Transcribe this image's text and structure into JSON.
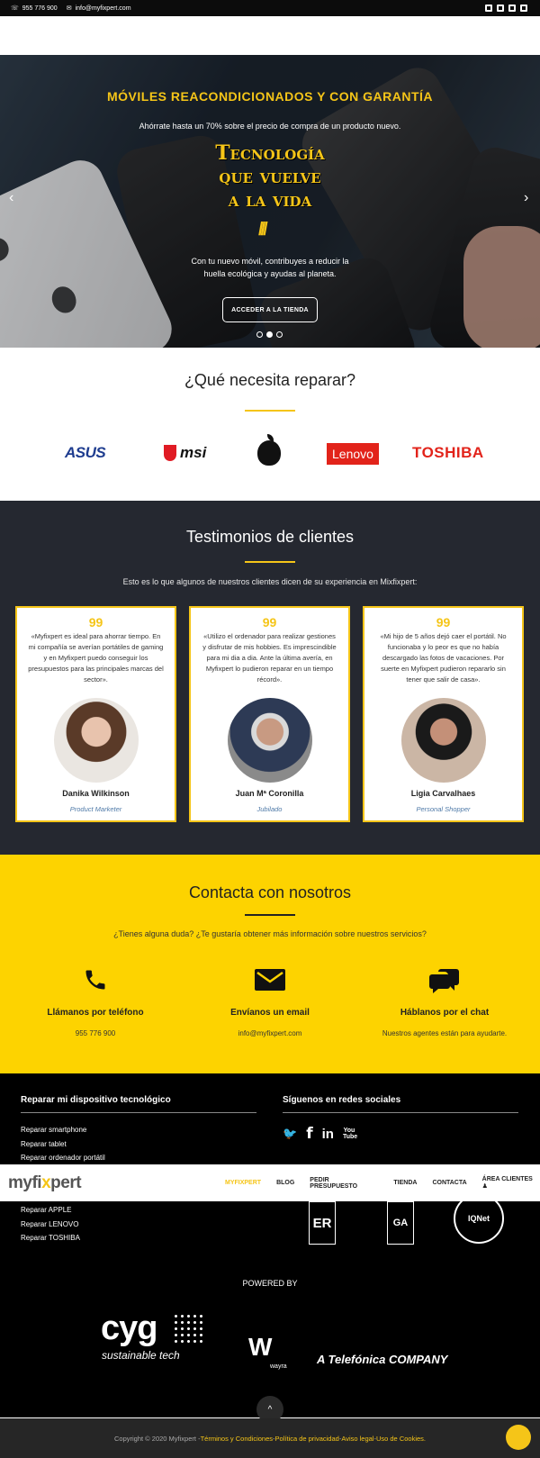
{
  "topbar": {
    "phone": "955 776 900",
    "email": "info@myfixpert.com",
    "social_icons": [
      "twitter-icon",
      "facebook-icon",
      "linkedin-icon",
      "youtube-icon"
    ]
  },
  "hero": {
    "title": "MÓVILES REACONDICIONADOS Y CON GARANTÍA",
    "subtitle": "Ahórrate hasta un 70% sobre el precio de compra de un producto nuevo.",
    "big_line1": "Tecnología",
    "big_line2": "que vuelve",
    "big_line3": "a la vida",
    "slash": "///",
    "text_line1": "Con tu nuevo móvil, contribuyes a reducir la",
    "text_line2": "huella ecológica y ayudas al planeta.",
    "button": "ACCEDER A LA TIENDA",
    "prev": "‹",
    "next": "›"
  },
  "repair": {
    "title": "¿Qué necesita reparar?",
    "brands": [
      "ASUS",
      "msi",
      "Lenovo",
      "TOSHIBA"
    ]
  },
  "testimonials": {
    "title": "Testimonios de clientes",
    "intro": "Esto es lo que algunos de nuestros clientes dicen de su experiencia en Mixfixpert:",
    "quote_mark": "99",
    "items": [
      {
        "quote": "«Myfixpert es ideal para ahorrar tiempo. En mi compañía se averían portátiles de gaming y en Myfixpert puedo conseguir los presupuestos para las principales marcas del sector».",
        "name": "Danika Wilkinson",
        "role": "Product Marketer"
      },
      {
        "quote": "«Utilizo el ordenador para realizar gestiones y disfrutar de mis hobbies. Es imprescindible para mi dia a dia. Ante la última avería, en Myfixpert lo pudieron reparar en un tiempo récord».",
        "name": "Juan Mª Coronilla",
        "role": "Jubilado"
      },
      {
        "quote": "«Mi hijo de 5 años dejó caer el portátil. No funcionaba y lo peor es que no había descargado las fotos de vacaciones. Por suerte en Myfixpert pudieron repararlo sin tener que salir de casa».",
        "name": "Ligia Carvalhaes",
        "role": "Personal Shopper"
      }
    ]
  },
  "contact": {
    "title": "Contacta con nosotros",
    "intro": "¿Tienes alguna duda? ¿Te gustaría obtener más información sobre nuestros servicios?",
    "items": [
      {
        "title": "Llámanos por teléfono",
        "value": "955 776 900"
      },
      {
        "title": "Envíanos un email",
        "value": "info@myfixpert.com"
      },
      {
        "title": "Háblanos por el chat",
        "value": "Nuestros agentes están para ayudarte."
      }
    ]
  },
  "footer": {
    "repair_title": "Reparar mi dispositivo tecnológico",
    "repair_links_top": [
      "Reparar smartphone",
      "Reparar tablet",
      "Reparar ordenador portátil"
    ],
    "repair_links_bottom": [
      "Reparar APPLE",
      "Reparar LENOVO",
      "Reparar TOSHIBA"
    ],
    "social_title": "Síguenos en redes sociales",
    "social": [
      "twitter-icon",
      "facebook-icon",
      "linkedin-icon",
      "youtube-icon"
    ],
    "social_glyphs": {
      "twitter": "🐦",
      "facebook": "f",
      "linkedin": "in",
      "youtube": "You Tube"
    },
    "powered_by": "POWERED BY",
    "cyg": "cyg",
    "cyg_sub": "sustainable tech",
    "wayra": "W",
    "wayra_sub": "wayra",
    "telefonica": "A Telefónica COMPANY",
    "cert1": "ER",
    "cert2": "GA",
    "cert3": "IQNet",
    "up_arrow": "^"
  },
  "navbar": {
    "logo_a": "myfi",
    "logo_x": "x",
    "logo_b": "pert",
    "items": [
      "MYFIXPERT",
      "BLOG",
      "PEDIR PRESUPUESTO",
      "TIENDA",
      "CONTACTA",
      "ÁREA CLIENTES"
    ]
  },
  "copyright": {
    "text": "Copyright © 2020 Myfixpert - ",
    "terms": "Términos y Condiciones",
    "privacy": "Política de privacidad",
    "legal": "Aviso legal",
    "cookies": "Uso de Cookies.",
    "sep": " - "
  },
  "colors": {
    "accent": "#f5c518",
    "dark": "#252830",
    "contact_bg": "#fdd300"
  }
}
